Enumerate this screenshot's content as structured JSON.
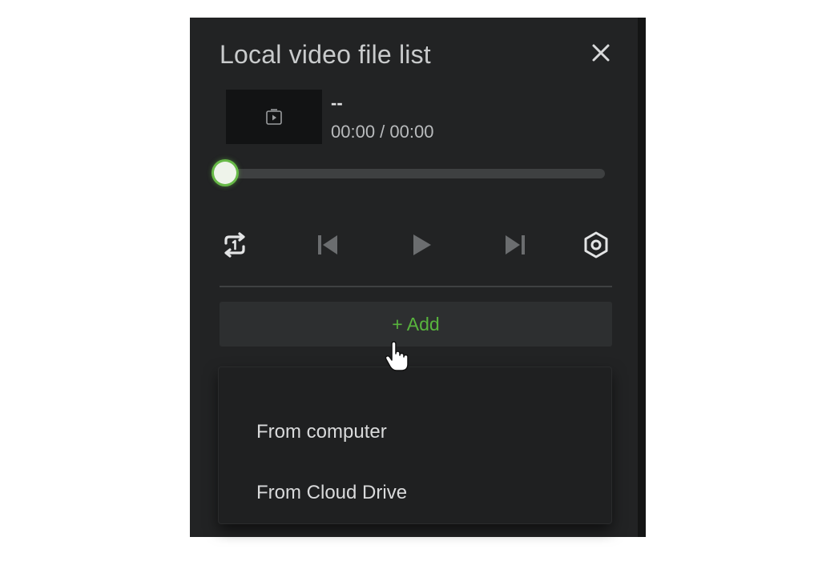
{
  "panel": {
    "title": "Local video file list",
    "close_icon": "close-icon"
  },
  "video": {
    "name": "--",
    "time": "00:00 / 00:00",
    "thumbnail_icon": "play-square-icon",
    "progress_fraction": 0.0
  },
  "controls": {
    "loop_icon": "repeat-one-icon",
    "previous_icon": "skip-previous-icon",
    "play_icon": "play-icon",
    "next_icon": "skip-next-icon",
    "settings_icon": "settings-hexagon-icon"
  },
  "add": {
    "label": "+ Add"
  },
  "menu": {
    "items": [
      {
        "label": "From computer"
      },
      {
        "label": "From Cloud Drive"
      }
    ]
  },
  "colors": {
    "accent": "#58b43d",
    "panel_bg": "#222324"
  }
}
